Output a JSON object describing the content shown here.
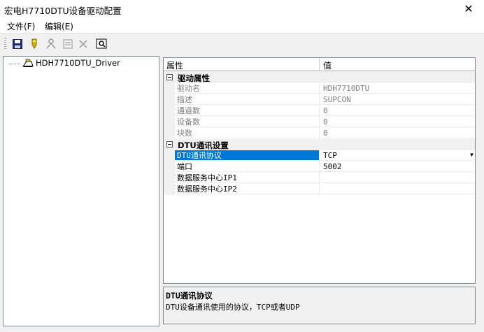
{
  "window": {
    "title": "宏电H7710DTU设备驱动配置",
    "close": "✕"
  },
  "menu": [
    {
      "label": "文件(F)"
    },
    {
      "label": "编辑(E)"
    }
  ],
  "toolbar": {
    "buttons": [
      "save-icon",
      "pencil-icon",
      "connect-icon",
      "list-icon",
      "delete-icon",
      "zoom-icon"
    ]
  },
  "tree": {
    "root": {
      "label": "HDH7710DTU_Driver",
      "icon": "driver-icon"
    }
  },
  "grid": {
    "headers": {
      "name": "属性",
      "value": "值"
    },
    "categories": [
      {
        "label": "驱动属性",
        "rows": [
          {
            "name": "驱动名",
            "value": "HDH7710DTU"
          },
          {
            "name": "描述",
            "value": "SUPCON"
          },
          {
            "name": "通道数",
            "value": "0"
          },
          {
            "name": "设备数",
            "value": "0"
          },
          {
            "name": "块数",
            "value": "0"
          }
        ]
      },
      {
        "label": "DTU通讯设置",
        "rows": [
          {
            "name": "DTU通讯协议",
            "value": "TCP"
          },
          {
            "name": "端口",
            "value": "5002"
          },
          {
            "name": "数据服务中心IP1",
            "value": ""
          },
          {
            "name": "数据服务中心IP2",
            "value": ""
          }
        ]
      }
    ]
  },
  "description": {
    "title": "DTU通讯协议",
    "text": "DTU设备通讯使用的协议，TCP或者UDP"
  },
  "colors": {
    "selection": "#0078d7",
    "disabled_text": "#808080"
  }
}
